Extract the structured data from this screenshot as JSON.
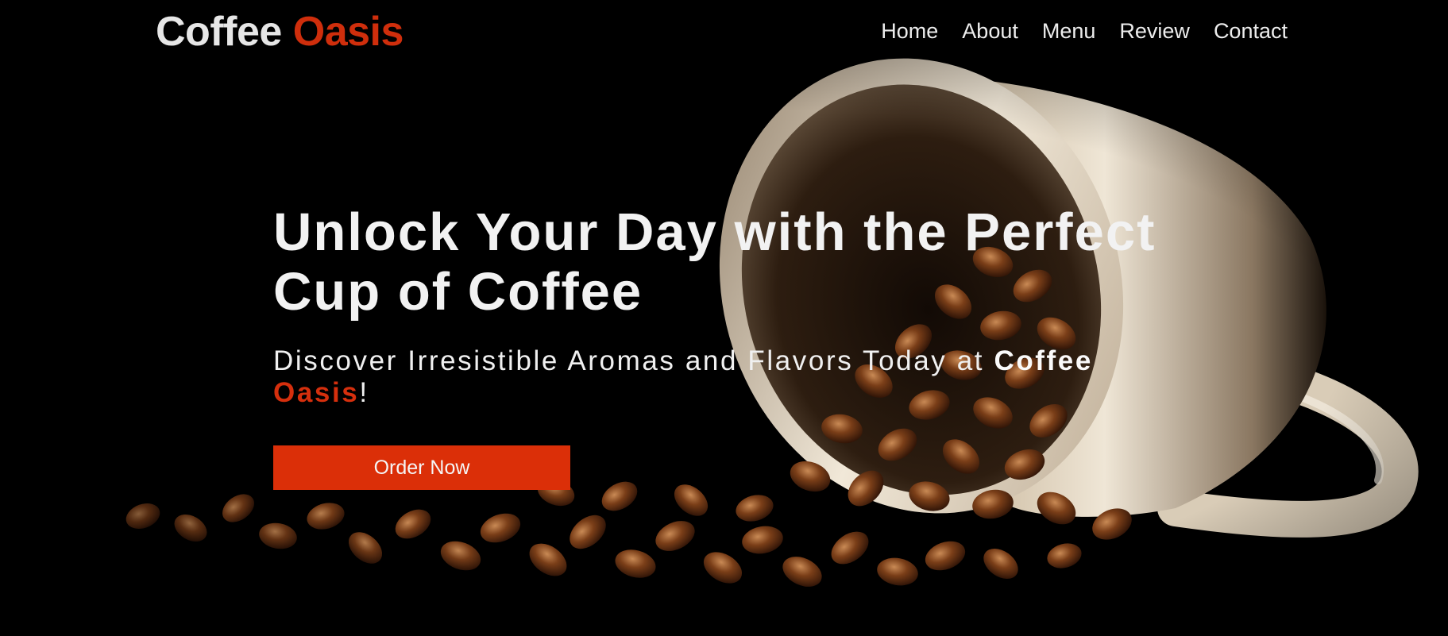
{
  "brand": {
    "name_first": "Coffee",
    "name_second": "Oasis"
  },
  "nav": {
    "items": [
      {
        "label": "Home"
      },
      {
        "label": "About"
      },
      {
        "label": "Menu"
      },
      {
        "label": "Review"
      },
      {
        "label": "Contact"
      }
    ]
  },
  "hero": {
    "title": "Unlock Your Day with the Perfect Cup of Coffee",
    "subtitle_prefix": "Discover Irresistible Aromas and Flavors Today at ",
    "subtitle_brand_first": "Coffee",
    "subtitle_brand_second": "Oasis",
    "subtitle_suffix": "!",
    "cta_label": "Order Now",
    "background_image": "coffee-cup-beans-image"
  },
  "colors": {
    "accent": "#cf2e0c",
    "button": "#db2f08",
    "background": "#000000",
    "text": "#f2f2f2"
  }
}
